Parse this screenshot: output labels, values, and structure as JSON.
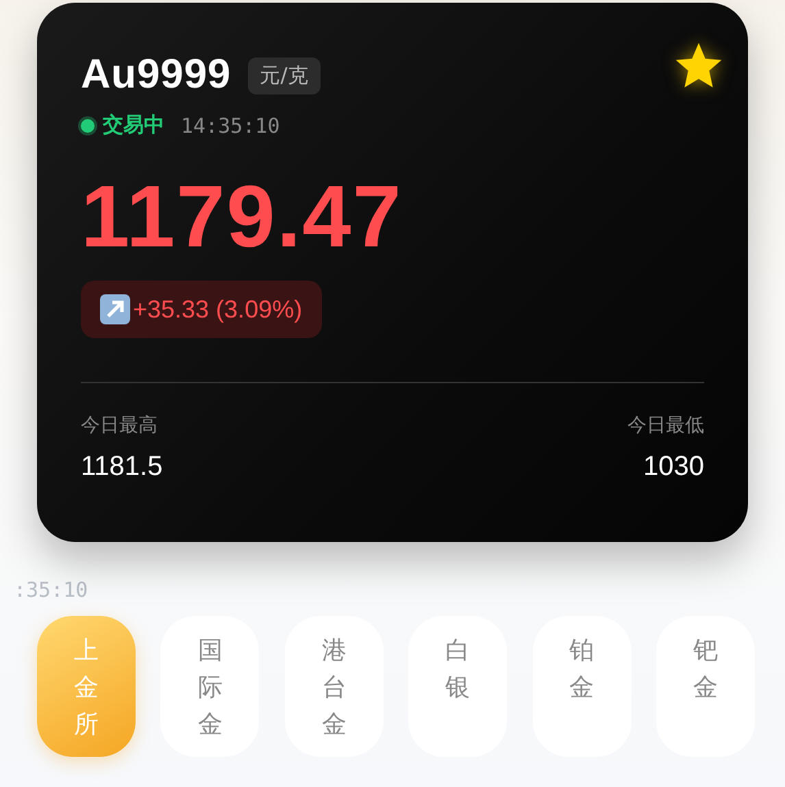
{
  "card": {
    "symbol": "Au9999",
    "unit": "元/克",
    "favorite": true,
    "status": {
      "label": "交易中",
      "color": "#22cc77"
    },
    "time": "14:35:10",
    "price": "1179.47",
    "change": {
      "rising": true,
      "text": "+35.33 (3.09%)"
    },
    "stats": [
      {
        "label": "今日最高",
        "value": "1181.5"
      },
      {
        "label": "今日最低",
        "value": "1030"
      }
    ]
  },
  "ghost_time": ":35:10",
  "tabs": [
    {
      "label": "上金所",
      "selected": true
    },
    {
      "label": "国际金",
      "selected": false
    },
    {
      "label": "港台金",
      "selected": false
    },
    {
      "label": "白银",
      "selected": false
    },
    {
      "label": "铂金",
      "selected": false
    },
    {
      "label": "钯金",
      "selected": false
    }
  ]
}
